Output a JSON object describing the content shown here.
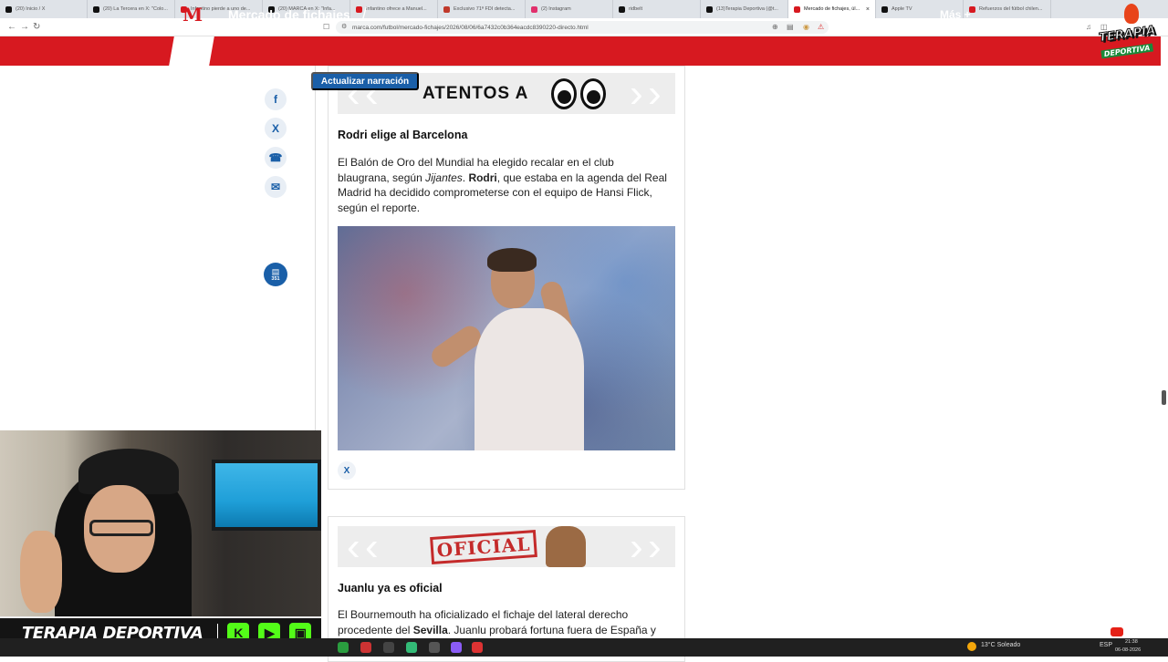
{
  "browser": {
    "tabs": [
      {
        "title": "(20) Inicio / X",
        "color": "#111111"
      },
      {
        "title": "(20) La Tercera en X: \"Colo...",
        "color": "#111111"
      },
      {
        "title": "Infantino pierde a uno de...",
        "color": "#d71920"
      },
      {
        "title": "(20) MARCA en X: \"Infa...",
        "color": "#111111"
      },
      {
        "title": "Infantino ofrece a Manuel...",
        "color": "#d71920"
      },
      {
        "title": "Exclusivo 71ª FDI detecta...",
        "color": "#c0392b"
      },
      {
        "title": "(2) Instagram",
        "color": "#e1306c"
      },
      {
        "title": "ridbelt",
        "color": "#111111"
      },
      {
        "title": "(13)Terapia Deportiva (@t...",
        "color": "#111111"
      },
      {
        "title": "Mercado de fichajes, úl...",
        "color": "#d71920",
        "active": true
      },
      {
        "title": "Apple TV",
        "color": "#111111"
      },
      {
        "title": "Refuerzos del fútbol chilen...",
        "color": "#d71920"
      }
    ],
    "url": "marca.com/futbol/mercado-fichajes/2026/08/06/6a7432c0b364eacdc8390220-directo.html"
  },
  "site": {
    "logo": "M",
    "section_title": "Mercado de fichajes",
    "more_label": "Más +",
    "brand_color": "#d71920"
  },
  "share": {
    "facebook": "f",
    "x": "X",
    "whatsapp": "☎",
    "email": "✉",
    "comments_count": "351"
  },
  "narration_button": "Actualizar narración",
  "entries": [
    {
      "banner": "ATENTOS A",
      "headline": "Rodri elige al Barcelona",
      "body_parts": [
        {
          "text": "El Balón de Oro del Mundial ha elegido recalar en el club blaugrana, según ",
          "style": "normal"
        },
        {
          "text": "Jijantes",
          "style": "italic"
        },
        {
          "text": ". ",
          "style": "normal"
        },
        {
          "text": "Rodri",
          "style": "bold"
        },
        {
          "text": ", que estaba en la agenda del Real Madrid ha decidido comprometerse con el equipo de Hansi Flick, según el reporte.",
          "style": "normal"
        }
      ],
      "embed_icon": "X"
    },
    {
      "banner": "OFICIAL",
      "headline": "Juanlu ya es oficial",
      "body_parts": [
        {
          "text": "El Bournemouth ha oficializado el fichaje del lateral derecho procedente del ",
          "style": "normal"
        },
        {
          "text": "Sevilla",
          "style": "bold"
        },
        {
          "text": ". Juanlu probará fortuna fuera de España y",
          "style": "normal"
        }
      ]
    }
  ],
  "overlay": {
    "badge_line1": "TERAPIA",
    "badge_line2": "DEPORTIVA",
    "bar_text": "TERAPIA DEPORTIVA",
    "socials": [
      {
        "name": "kick",
        "glyph": "K",
        "color": "#53fc18"
      },
      {
        "name": "youtube",
        "glyph": "▶",
        "color": "#53fc18"
      },
      {
        "name": "twitch",
        "glyph": "▣",
        "color": "#53fc18"
      }
    ]
  },
  "taskbar": {
    "weather": "13°C  Soleado",
    "lang": "ESP",
    "time": "21:38",
    "date": "06-08-2026"
  }
}
